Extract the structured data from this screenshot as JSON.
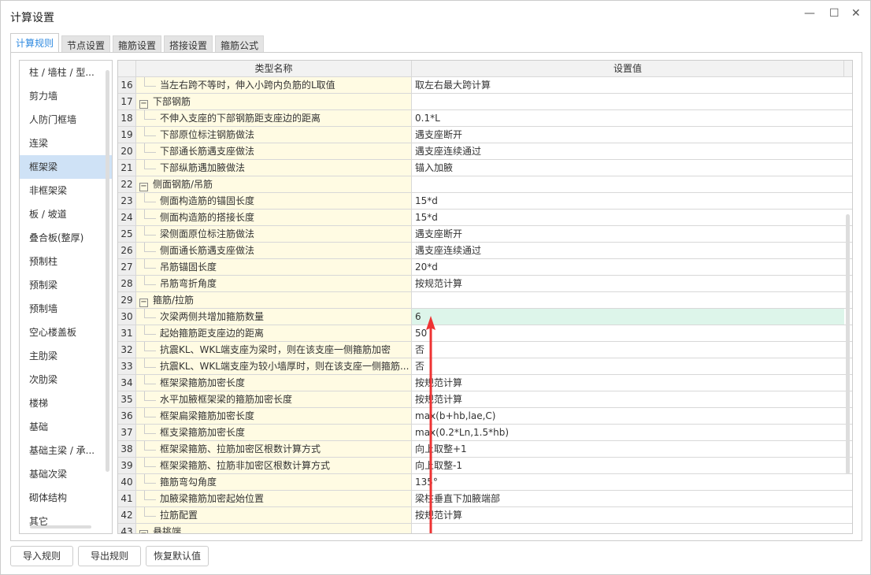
{
  "window": {
    "title": "计算设置",
    "minimize": "—",
    "maximize": "☐",
    "close": "✕"
  },
  "tabs": [
    "计算规则",
    "节点设置",
    "箍筋设置",
    "搭接设置",
    "箍筋公式"
  ],
  "sidebar": {
    "items": [
      "柱 / 墙柱 / 型...",
      "剪力墙",
      "人防门框墙",
      "连梁",
      "框架梁",
      "非框架梁",
      "板 / 坡道",
      "叠合板(整厚)",
      "预制柱",
      "预制梁",
      "预制墙",
      "空心楼盖板",
      "主肋梁",
      "次肋梁",
      "楼梯",
      "基础",
      "基础主梁 / 承...",
      "基础次梁",
      "砌体结构",
      "其它"
    ],
    "selected": "框架梁"
  },
  "table": {
    "headers": [
      "类型名称",
      "设置值"
    ],
    "rows": [
      {
        "n": "16",
        "name": "当左右跨不等时，伸入小跨内负筋的L取值",
        "value": "取左右最大跨计算",
        "type": "child"
      },
      {
        "n": "17",
        "name": "下部钢筋",
        "value": "",
        "type": "group"
      },
      {
        "n": "18",
        "name": "不伸入支座的下部钢筋距支座边的距离",
        "value": "0.1*L",
        "type": "child"
      },
      {
        "n": "19",
        "name": "下部原位标注钢筋做法",
        "value": "遇支座断开",
        "type": "child"
      },
      {
        "n": "20",
        "name": "下部通长筋遇支座做法",
        "value": "遇支座连续通过",
        "type": "child"
      },
      {
        "n": "21",
        "name": "下部纵筋遇加腋做法",
        "value": "锚入加腋",
        "type": "child"
      },
      {
        "n": "22",
        "name": "侧面钢筋/吊筋",
        "value": "",
        "type": "group"
      },
      {
        "n": "23",
        "name": "侧面构造筋的锚固长度",
        "value": "15*d",
        "type": "child"
      },
      {
        "n": "24",
        "name": "侧面构造筋的搭接长度",
        "value": "15*d",
        "type": "child"
      },
      {
        "n": "25",
        "name": "梁侧面原位标注筋做法",
        "value": "遇支座断开",
        "type": "child"
      },
      {
        "n": "26",
        "name": "侧面通长筋遇支座做法",
        "value": "遇支座连续通过",
        "type": "child"
      },
      {
        "n": "27",
        "name": "吊筋锚固长度",
        "value": "20*d",
        "type": "child"
      },
      {
        "n": "28",
        "name": "吊筋弯折角度",
        "value": "按规范计算",
        "type": "child"
      },
      {
        "n": "29",
        "name": "箍筋/拉筋",
        "value": "",
        "type": "group"
      },
      {
        "n": "30",
        "name": "次梁两侧共增加箍筋数量",
        "value": "6",
        "type": "child",
        "highlight": true
      },
      {
        "n": "31",
        "name": "起始箍筋距支座边的距离",
        "value": "50",
        "type": "child"
      },
      {
        "n": "32",
        "name": "抗震KL、WKL端支座为梁时，则在该支座一侧箍筋加密",
        "value": "否",
        "type": "child"
      },
      {
        "n": "33",
        "name": "抗震KL、WKL端支座为较小墙厚时，则在该支座一侧箍筋...",
        "value": "否",
        "type": "child"
      },
      {
        "n": "34",
        "name": "框架梁箍筋加密长度",
        "value": "按规范计算",
        "type": "child"
      },
      {
        "n": "35",
        "name": "水平加腋框架梁的箍筋加密长度",
        "value": "按规范计算",
        "type": "child"
      },
      {
        "n": "36",
        "name": "框架扁梁箍筋加密长度",
        "value": "max(b+hb,lae,C)",
        "type": "child"
      },
      {
        "n": "37",
        "name": "框支梁箍筋加密长度",
        "value": "max(0.2*Ln,1.5*hb)",
        "type": "child"
      },
      {
        "n": "38",
        "name": "框架梁箍筋、拉筋加密区根数计算方式",
        "value": "向上取整+1",
        "type": "child"
      },
      {
        "n": "39",
        "name": "框架梁箍筋、拉筋非加密区根数计算方式",
        "value": "向上取整-1",
        "type": "child"
      },
      {
        "n": "40",
        "name": "箍筋弯勾角度",
        "value": "135°",
        "type": "child"
      },
      {
        "n": "41",
        "name": "加腋梁箍筋加密起始位置",
        "value": "梁柱垂直下加腋端部",
        "type": "child"
      },
      {
        "n": "42",
        "name": "拉筋配置",
        "value": "按规范计算",
        "type": "child"
      },
      {
        "n": "43",
        "name": "悬挑端",
        "value": "",
        "type": "group"
      }
    ]
  },
  "buttons": {
    "import": "导入规则",
    "export": "导出规则",
    "restore": "恢复默认值"
  },
  "colors": {
    "accent": "#2f8ae0",
    "annotation_arrow": "#ee3333",
    "highlight_row": "#ddf5ea",
    "name_column": "#fffbe3"
  }
}
